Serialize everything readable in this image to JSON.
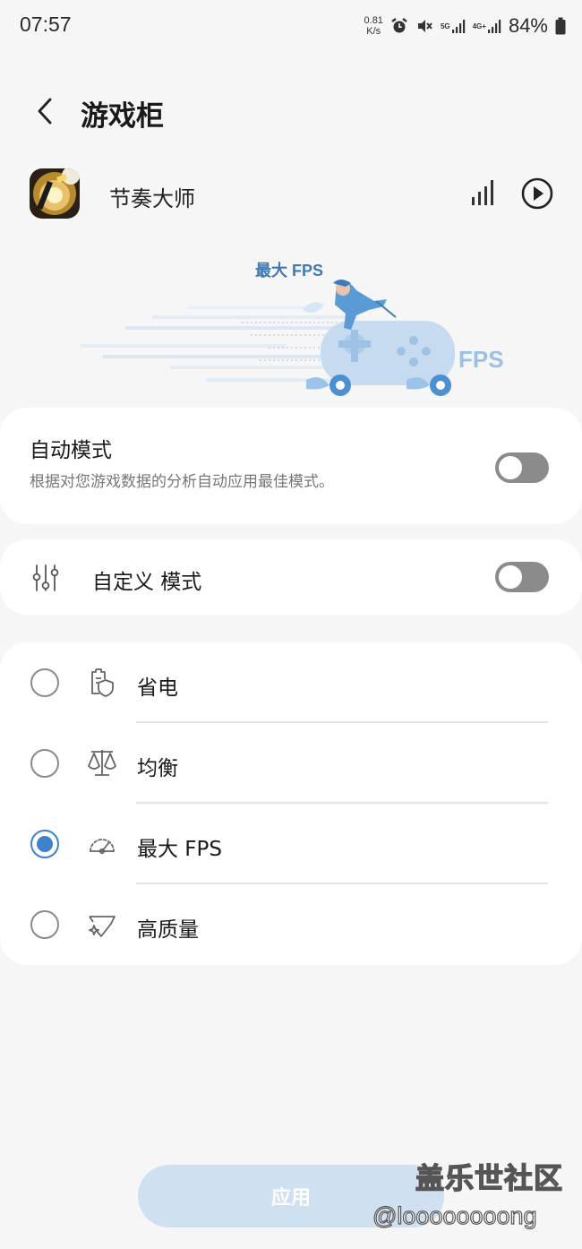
{
  "status_bar": {
    "time": "07:57",
    "net_speed_value": "0.81",
    "net_speed_unit": "K/s",
    "label_5g": "5G",
    "label_4g": "4G+",
    "battery": "84%"
  },
  "header": {
    "title": "游戏柜"
  },
  "app": {
    "name": "节奏大师"
  },
  "hero": {
    "title": "最大 FPS",
    "fps_text": "FPS"
  },
  "auto_mode": {
    "title": "自动模式",
    "description": "根据对您游戏数据的分析自动应用最佳模式。",
    "enabled": false
  },
  "custom_mode": {
    "label": "自定义 模式",
    "enabled": false
  },
  "modes": [
    {
      "label": "省电",
      "icon": "battery-shield-icon",
      "selected": false
    },
    {
      "label": "均衡",
      "icon": "balance-scale-icon",
      "selected": false
    },
    {
      "label": "最大 FPS",
      "icon": "speedometer-icon",
      "selected": true
    },
    {
      "label": "高质量",
      "icon": "diamond-sparkle-icon",
      "selected": false
    }
  ],
  "apply_button": {
    "label": "应用"
  },
  "watermark": {
    "line1": "盖乐世社区",
    "line2": "@loooooooong"
  },
  "colors": {
    "accent": "#3e82cc",
    "apply_disabled": "#cfe0f1",
    "background": "#f6f6f6"
  }
}
